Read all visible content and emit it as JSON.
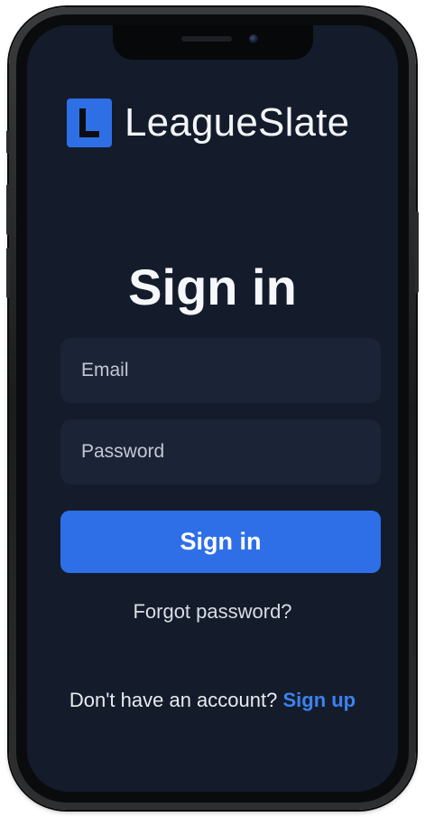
{
  "app": {
    "brand_name": "LeagueSlate",
    "logo_letter": "L",
    "accent_color": "#2f6fe6"
  },
  "signin": {
    "title": "Sign in",
    "email_placeholder": "Email",
    "password_placeholder": "Password",
    "submit_label": "Sign in",
    "forgot_password": "Forgot password?",
    "no_account_prompt": "Don't have an account?",
    "signup_label": "Sign up"
  },
  "icons": {
    "logo": "letter-l-logo-icon",
    "camera": "front-camera",
    "speaker": "earpiece-speaker"
  }
}
